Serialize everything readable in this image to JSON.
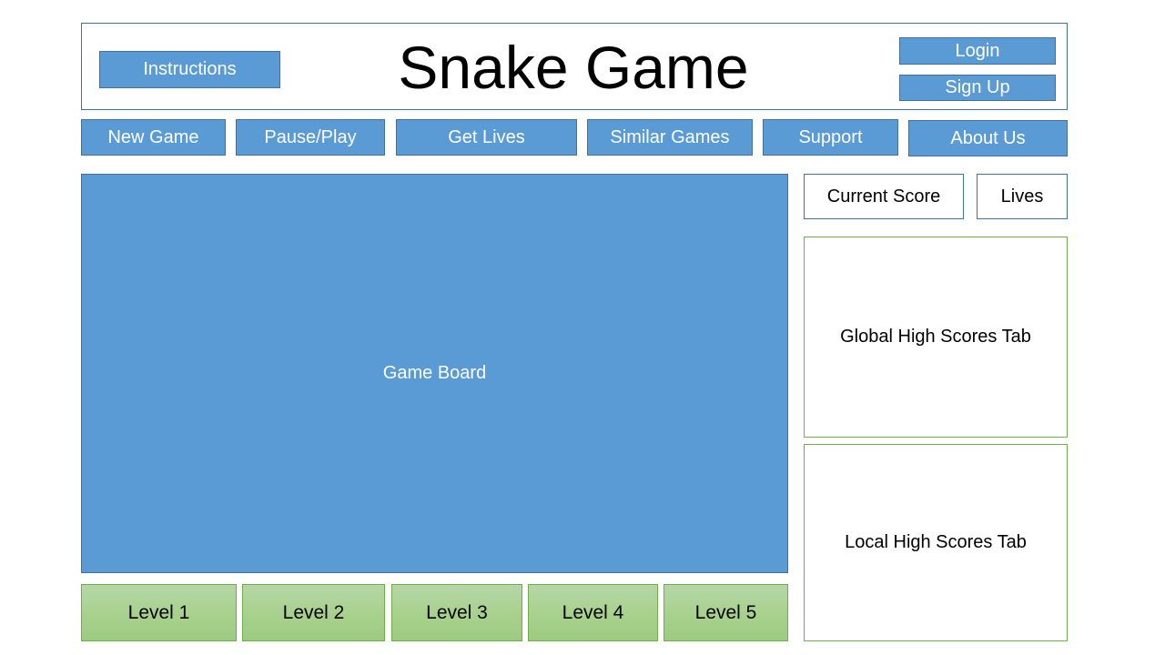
{
  "header": {
    "title": "Snake Game",
    "instructions_label": "Instructions",
    "login_label": "Login",
    "signup_label": "Sign Up"
  },
  "nav": {
    "items": [
      {
        "label": "New Game"
      },
      {
        "label": "Pause/Play"
      },
      {
        "label": "Get Lives"
      },
      {
        "label": "Similar Games"
      },
      {
        "label": "Support"
      },
      {
        "label": "About Us"
      }
    ]
  },
  "main": {
    "board_label": "Game Board"
  },
  "levels": {
    "items": [
      {
        "label": "Level 1"
      },
      {
        "label": "Level 2"
      },
      {
        "label": "Level 3"
      },
      {
        "label": "Level 4"
      },
      {
        "label": "Level 5"
      }
    ]
  },
  "sidebar": {
    "current_score_label": "Current Score",
    "lives_label": "Lives",
    "global_scores_label": "Global High Scores Tab",
    "local_scores_label": "Local High Scores Tab"
  },
  "colors": {
    "primary_blue": "#5b9bd5",
    "blue_border": "#41719c",
    "level_green": "#a9d18e",
    "green_border": "#70ad47"
  }
}
